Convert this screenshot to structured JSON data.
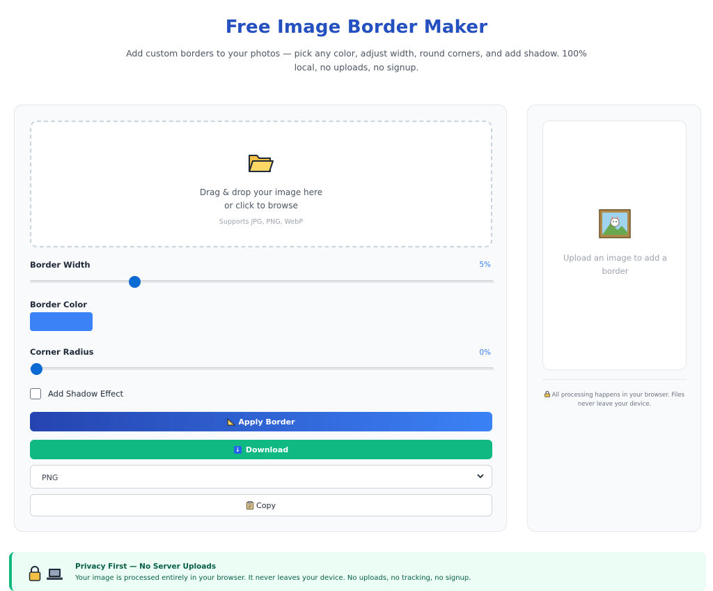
{
  "header": {
    "title": "Free Image Border Maker",
    "subtitle": "Add custom borders to your photos — pick any color, adjust width, round corners, and add shadow. 100% local, no uploads, no signup."
  },
  "dropzone": {
    "line1": "Drag & drop your image here",
    "line2": "or click to browse",
    "formats": "Supports JPG, PNG, WebP",
    "icon": "folder-icon"
  },
  "controls": {
    "border_width": {
      "label": "Border Width",
      "value_text": "5%",
      "value": 5,
      "min": 0,
      "max": 23
    },
    "border_color": {
      "label": "Border Color",
      "value": "#3b82f6"
    },
    "corner_radius": {
      "label": "Corner Radius",
      "value_text": "0%",
      "value": 0,
      "min": 0,
      "max": 50
    },
    "shadow": {
      "label": "Add Shadow Effect",
      "checked": false
    }
  },
  "buttons": {
    "apply": {
      "label": "Apply Border",
      "icon": "ruler-triangle-icon"
    },
    "download": {
      "label": "Download",
      "icon": "download-icon"
    },
    "copy": {
      "label": "Copy",
      "icon": "clipboard-icon"
    }
  },
  "format_select": {
    "selected": "PNG"
  },
  "preview": {
    "placeholder": "Upload an image to add a border",
    "note": "All processing happens in your browser. Files never leave your device.",
    "icon": "framed-picture-icon"
  },
  "privacy": {
    "title": "Privacy First — No Server Uploads",
    "text": "Your image is processed entirely in your browser. It never leaves your device. No uploads, no tracking, no signup."
  },
  "colors": {
    "title": "#2550c0",
    "accent": "#3b82f6",
    "download": "#10b981",
    "banner_bg": "#ecfdf5"
  }
}
